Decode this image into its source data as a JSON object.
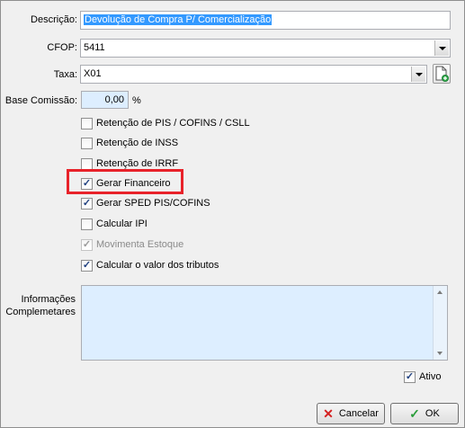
{
  "form": {
    "descricao_label": "Descrição:",
    "descricao_value": "Devolução de Compra P/ Comercialização",
    "cfop_label": "CFOP:",
    "cfop_value": "5411",
    "taxa_label": "Taxa:",
    "taxa_value": "X01",
    "base_comissao_label": "Base Comissão:",
    "base_comissao_value": "0,00",
    "base_comissao_unit": "%",
    "informacoes_label_line1": "Informações",
    "informacoes_label_line2": "Complemetares",
    "informacoes_value": ""
  },
  "checkboxes": [
    {
      "label": "Retenção de PIS / COFINS / CSLL",
      "checked": false,
      "enabled": true
    },
    {
      "label": "Retenção de INSS",
      "checked": false,
      "enabled": true
    },
    {
      "label": "Retenção de IRRF",
      "checked": false,
      "enabled": true
    },
    {
      "label": "Gerar Financeiro",
      "checked": true,
      "enabled": true
    },
    {
      "label": "Gerar SPED PIS/COFINS",
      "checked": true,
      "enabled": true
    },
    {
      "label": "Calcular IPI",
      "checked": false,
      "enabled": true
    },
    {
      "label": "Movimenta Estoque",
      "checked": true,
      "enabled": false
    },
    {
      "label": "Calcular o valor dos tributos",
      "checked": true,
      "enabled": true
    }
  ],
  "ativo": {
    "label": "Ativo",
    "checked": true
  },
  "buttons": {
    "cancel_label": "Cancelar",
    "ok_label": "OK"
  },
  "icons": {
    "cancel": "close-x-icon",
    "ok": "checkmark-icon",
    "new_doc": "new-document-icon"
  },
  "colors": {
    "highlight": "#e8222a",
    "selection": "#3399ff",
    "memo_background": "#ddeeff"
  }
}
